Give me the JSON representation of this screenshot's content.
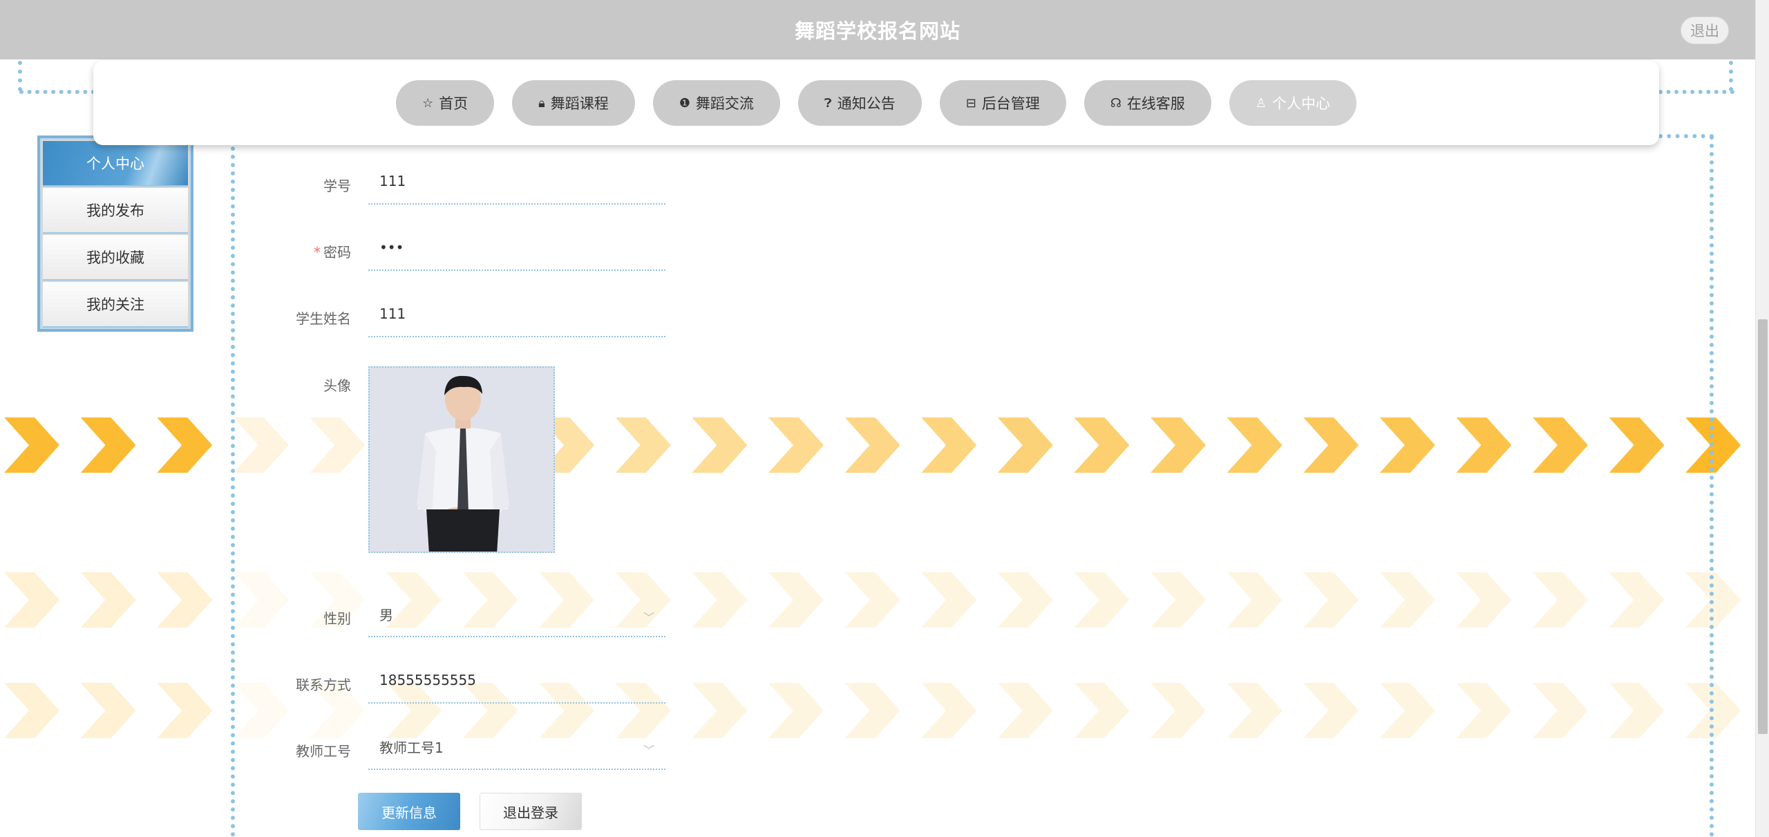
{
  "header": {
    "title": "舞蹈学校报名网站",
    "logout_label": "退出"
  },
  "nav": {
    "items": [
      {
        "label": "首页",
        "icon": "star-icon"
      },
      {
        "label": "舞蹈课程",
        "icon": "lock-icon"
      },
      {
        "label": "舞蹈交流",
        "icon": "info-circle-icon"
      },
      {
        "label": "通知公告",
        "icon": "question-circle-icon"
      },
      {
        "label": "后台管理",
        "icon": "box-icon"
      },
      {
        "label": "在线客服",
        "icon": "headset-icon"
      },
      {
        "label": "个人中心",
        "icon": "user-icon",
        "active": true
      }
    ]
  },
  "sidebar": {
    "items": [
      {
        "label": "个人中心",
        "active": true
      },
      {
        "label": "我的发布"
      },
      {
        "label": "我的收藏"
      },
      {
        "label": "我的关注"
      }
    ]
  },
  "form": {
    "student_no": {
      "label": "学号",
      "value": "111"
    },
    "password": {
      "label": "密码",
      "value": "•••",
      "required_mark": "*"
    },
    "student_name": {
      "label": "学生姓名",
      "value": "111"
    },
    "avatar": {
      "label": "头像"
    },
    "gender": {
      "label": "性别",
      "value": "男"
    },
    "contact": {
      "label": "联系方式",
      "value": "18555555555"
    },
    "teacher_no": {
      "label": "教师工号",
      "value": "教师工号1"
    }
  },
  "buttons": {
    "update": "更新信息",
    "logout": "退出登录"
  },
  "colors": {
    "accent": "#5aa6dc",
    "chevron": "#fbb829",
    "topbar": "#c8c8c8",
    "dots": "#8ec3e3"
  }
}
